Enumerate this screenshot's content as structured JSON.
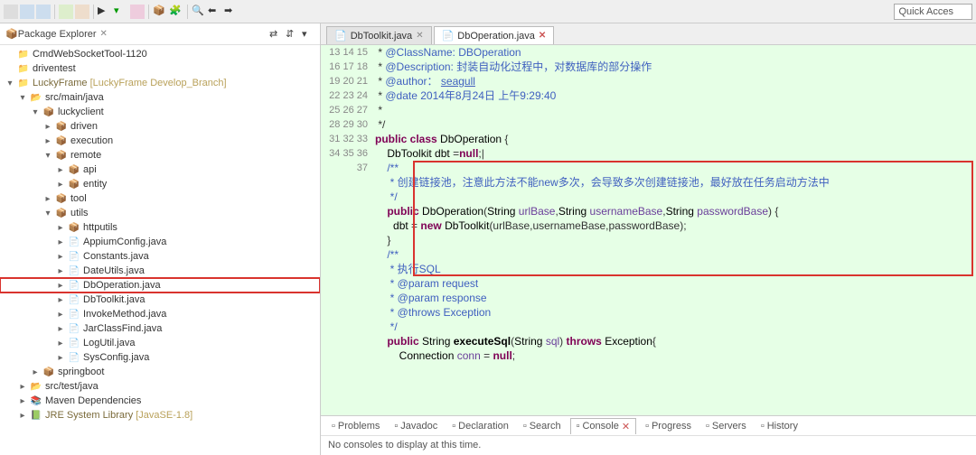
{
  "toolbar": {
    "quick_access": "Quick Acces"
  },
  "package_explorer": {
    "title": "Package Explorer",
    "x": "✕",
    "tree": [
      {
        "indent": 0,
        "twist": "",
        "icon": "ic-proj",
        "label": "CmdWebSocketTool-1120"
      },
      {
        "indent": 0,
        "twist": "",
        "icon": "ic-proj",
        "label": "driventest"
      },
      {
        "indent": 0,
        "twist": "v",
        "icon": "ic-proj",
        "label": "LuckyFrame",
        "suffix": "[LuckyFrame Develop_Branch]",
        "link": true
      },
      {
        "indent": 1,
        "twist": "v",
        "icon": "ic-src",
        "label": "src/main/java"
      },
      {
        "indent": 2,
        "twist": "v",
        "icon": "ic-pkg",
        "label": "luckyclient"
      },
      {
        "indent": 3,
        "twist": ">",
        "icon": "ic-pkg",
        "label": "driven"
      },
      {
        "indent": 3,
        "twist": ">",
        "icon": "ic-pkg",
        "label": "execution"
      },
      {
        "indent": 3,
        "twist": "v",
        "icon": "ic-pkg",
        "label": "remote"
      },
      {
        "indent": 4,
        "twist": ">",
        "icon": "ic-pkg",
        "label": "api"
      },
      {
        "indent": 4,
        "twist": ">",
        "icon": "ic-pkg",
        "label": "entity"
      },
      {
        "indent": 3,
        "twist": ">",
        "icon": "ic-pkg",
        "label": "tool"
      },
      {
        "indent": 3,
        "twist": "v",
        "icon": "ic-pkg",
        "label": "utils"
      },
      {
        "indent": 4,
        "twist": ">",
        "icon": "ic-pkg",
        "label": "httputils"
      },
      {
        "indent": 4,
        "twist": ">",
        "icon": "ic-jfile",
        "label": "AppiumConfig.java"
      },
      {
        "indent": 4,
        "twist": ">",
        "icon": "ic-jfile",
        "label": "Constants.java"
      },
      {
        "indent": 4,
        "twist": ">",
        "icon": "ic-jfile",
        "label": "DateUtils.java"
      },
      {
        "indent": 4,
        "twist": ">",
        "icon": "ic-jfile",
        "label": "DbOperation.java",
        "selected": true
      },
      {
        "indent": 4,
        "twist": ">",
        "icon": "ic-jfile",
        "label": "DbToolkit.java"
      },
      {
        "indent": 4,
        "twist": ">",
        "icon": "ic-jfile",
        "label": "InvokeMethod.java"
      },
      {
        "indent": 4,
        "twist": ">",
        "icon": "ic-jfile",
        "label": "JarClassFind.java"
      },
      {
        "indent": 4,
        "twist": ">",
        "icon": "ic-jfile",
        "label": "LogUtil.java"
      },
      {
        "indent": 4,
        "twist": ">",
        "icon": "ic-jfile",
        "label": "SysConfig.java"
      },
      {
        "indent": 2,
        "twist": ">",
        "icon": "ic-pkg",
        "label": "springboot"
      },
      {
        "indent": 1,
        "twist": ">",
        "icon": "ic-src",
        "label": "src/test/java"
      },
      {
        "indent": 1,
        "twist": ">",
        "icon": "ic-lib",
        "label": "Maven Dependencies"
      },
      {
        "indent": 1,
        "twist": ">",
        "icon": "ic-jre",
        "label": "JRE System Library",
        "suffix": "[JavaSE-1.8]",
        "link": true
      }
    ]
  },
  "editor": {
    "tabs": [
      {
        "label": "DbToolkit.java",
        "active": false
      },
      {
        "label": "DbOperation.java",
        "active": true
      }
    ],
    "lines": [
      {
        "n": 13,
        "html": " * <span class='cm'>@ClassName:</span> <span class='cm'>DBOperation</span>"
      },
      {
        "n": 14,
        "html": " * <span class='cm'>@Description:</span> <span class='cm'>封装自动化过程中，对数据库的部分操作</span>"
      },
      {
        "n": 15,
        "html": " * <span class='cm'>@author：</span> <span class='cm' style='text-decoration:underline'>seagull</span>"
      },
      {
        "n": 16,
        "html": " * <span class='cm'>@date</span> <span class='cm'>2014年8月24日 上午9:29:40</span>"
      },
      {
        "n": 17,
        "html": " *"
      },
      {
        "n": 18,
        "html": " */"
      },
      {
        "n": 19,
        "html": "<span class='kw'>public class</span> <span class='type'>DbOperation</span> {"
      },
      {
        "n": 20,
        "html": ""
      },
      {
        "n": 21,
        "html": "    <span class='type'>DbToolkit</span> <span class='dark'>dbt</span> =<span class='kw'>null</span>;|"
      },
      {
        "n": 22,
        "html": "    <span class='cm'>/**</span>"
      },
      {
        "n": 23,
        "html": "     <span class='cm'>* 创建链接池，注意此方法不能new多次，会导致多次创建链接池，最好放在任务启动方法中</span>"
      },
      {
        "n": 24,
        "html": "     <span class='cm'>*/</span>"
      },
      {
        "n": 25,
        "html": "    <span class='kw'>public</span> <span class='fn'>DbOperation</span>(<span class='type'>String</span> <span style='color:#6a3e9a'>urlBase</span>,<span class='type'>String</span> <span style='color:#6a3e9a'>usernameBase</span>,<span class='type'>String</span> <span style='color:#6a3e9a'>passwordBase</span>) {"
      },
      {
        "n": 26,
        "html": "      <span class='dark'>dbt</span> = <span class='kw'>new</span> <span class='type'>DbToolkit</span>(urlBase,usernameBase,passwordBase);"
      },
      {
        "n": 27,
        "html": "    }"
      },
      {
        "n": 28,
        "html": ""
      },
      {
        "n": 29,
        "html": ""
      },
      {
        "n": 30,
        "html": "    <span class='cm'>/**</span>"
      },
      {
        "n": 31,
        "html": "     <span class='cm'>* 执行SQL</span>"
      },
      {
        "n": 32,
        "html": "     <span class='cm'>* @param request</span>"
      },
      {
        "n": 33,
        "html": "     <span class='cm'>* @param response</span>"
      },
      {
        "n": 34,
        "html": "     <span class='cm'>* @throws Exception</span>"
      },
      {
        "n": 35,
        "html": "     <span class='cm'>*/</span>"
      },
      {
        "n": 36,
        "html": "    <span class='kw'>public</span> <span class='type'>String</span> <span class='fn' style='font-weight:bold'>executeSql</span>(<span class='type'>String</span> <span style='color:#6a3e9a'>sql</span>) <span class='kw'>throws</span> <span class='type'>Exception</span>{"
      },
      {
        "n": 37,
        "html": "        <span class='type'>Connection</span> <span style='color:#6a3e9a'>conn</span> = <span class='kw'>null</span>;"
      }
    ]
  },
  "bottom": {
    "tabs": [
      "Problems",
      "Javadoc",
      "Declaration",
      "Search",
      "Console",
      "Progress",
      "Servers",
      "History"
    ],
    "active": "Console",
    "msg": "No consoles to display at this time."
  }
}
